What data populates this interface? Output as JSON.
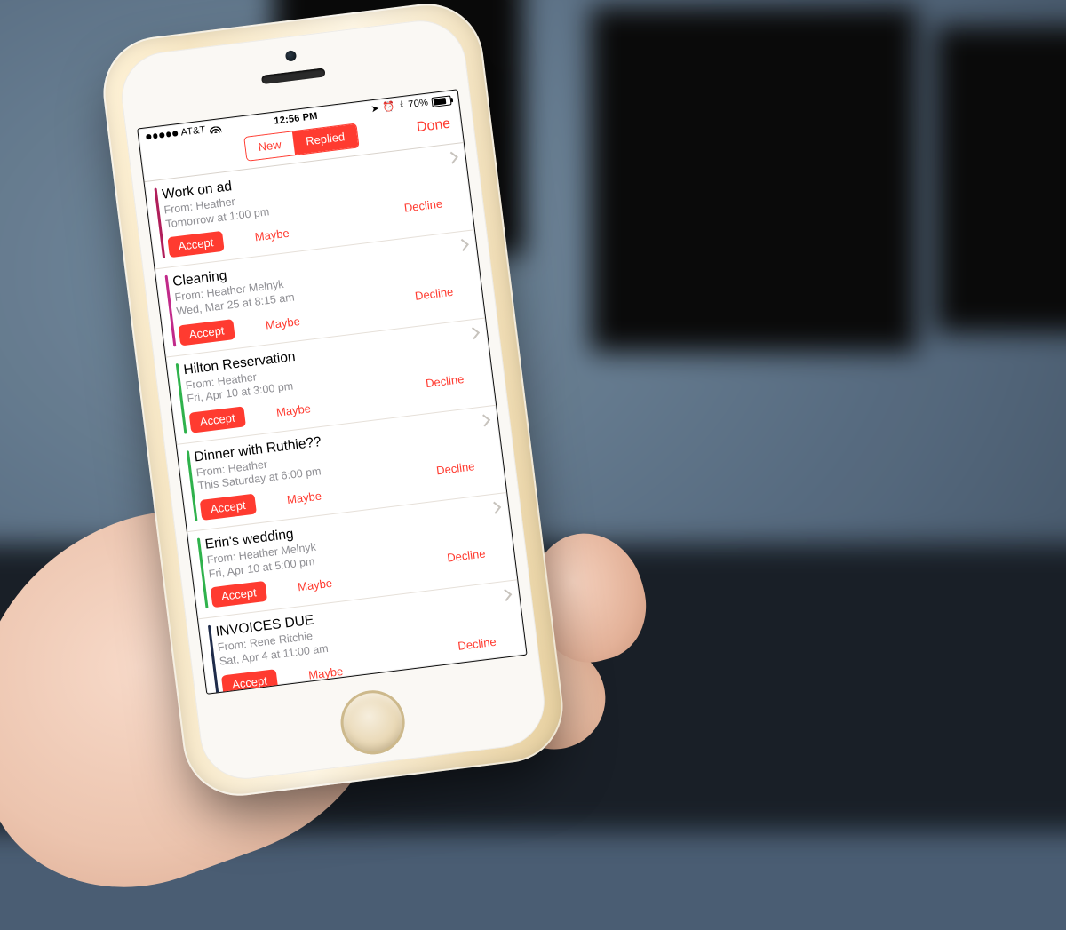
{
  "status": {
    "carrier": "AT&T",
    "time": "12:56 PM",
    "battery": "70%"
  },
  "nav": {
    "segment_new": "New",
    "segment_replied": "Replied",
    "done": "Done"
  },
  "actions": {
    "accept": "Accept",
    "maybe": "Maybe",
    "decline": "Decline"
  },
  "invites": [
    {
      "title": "Work on ad",
      "from": "From: Heather",
      "when": "Tomorrow at 1:00 pm"
    },
    {
      "title": "Cleaning",
      "from": "From: Heather Melnyk",
      "when": "Wed, Mar 25 at 8:15 am"
    },
    {
      "title": "Hilton Reservation",
      "from": "From: Heather",
      "when": "Fri, Apr 10 at 3:00 pm"
    },
    {
      "title": "Dinner with Ruthie??",
      "from": "From: Heather",
      "when": "This Saturday at 6:00 pm"
    },
    {
      "title": "Erin's wedding",
      "from": "From: Heather Melnyk",
      "when": "Fri, Apr 10 at 5:00 pm"
    },
    {
      "title": "INVOICES DUE",
      "from": "From: Rene Ritchie",
      "when": "Sat, Apr 4 at 11:00 am"
    }
  ]
}
